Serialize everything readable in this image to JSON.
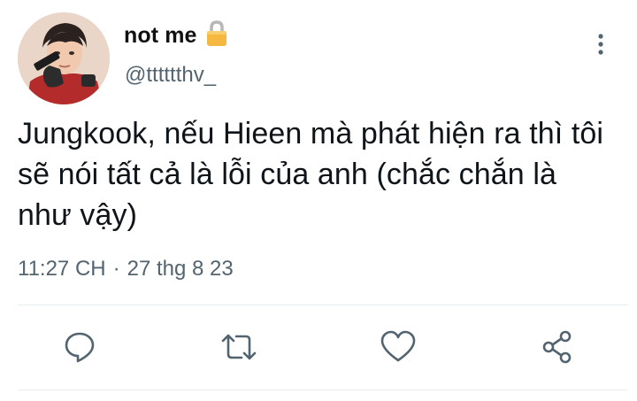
{
  "author": {
    "display_name": "not me",
    "handle": "@tttttthv_",
    "lock_icon": "lock-icon",
    "verified": false
  },
  "tweet": {
    "text_lines": [
      "Jungkook, nếu Hieen mà phát hiện ra thì tôi",
      "sẽ nói tất cả là lỗi của anh (chắc chắn là",
      "như vậy)"
    ],
    "time": "11:27 CH",
    "separator": "·",
    "date": "27 thg 8 23"
  },
  "actions": {
    "reply_icon": "reply-icon",
    "retweet_icon": "retweet-icon",
    "like_icon": "heart-icon",
    "share_icon": "share-icon",
    "more_icon": "more-vertical-icon"
  },
  "colors": {
    "text": "#0f1419",
    "secondary": "#536471",
    "icon": "#536471",
    "divider": "#e6ecf0",
    "lock": "#f5b942"
  }
}
